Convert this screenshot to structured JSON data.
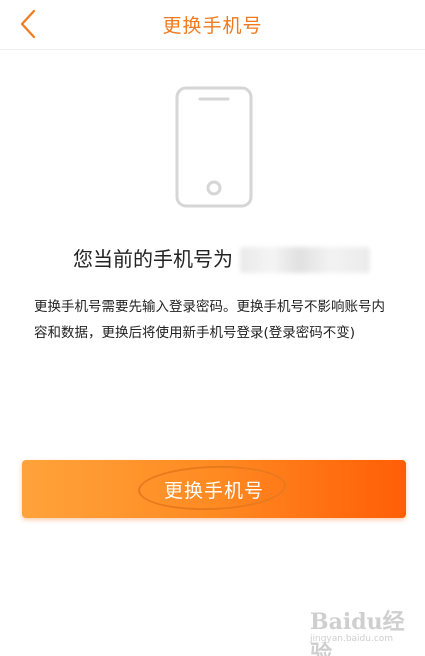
{
  "header": {
    "title": "更换手机号"
  },
  "current_number": {
    "label": "您当前的手机号为"
  },
  "notice": {
    "text": "更换手机号需要先输入登录密码。更换手机号不影响账号内容和数据，更换后将使用新手机号登录(登录密码不变)"
  },
  "primary_button": {
    "label": "更换手机号"
  },
  "watermark": {
    "logo": "Baidu经验",
    "site": "jingyan.baidu.com"
  },
  "colors": {
    "accent": "#f07a1f",
    "button_start": "#ffa33a",
    "button_end": "#ff5e07"
  }
}
